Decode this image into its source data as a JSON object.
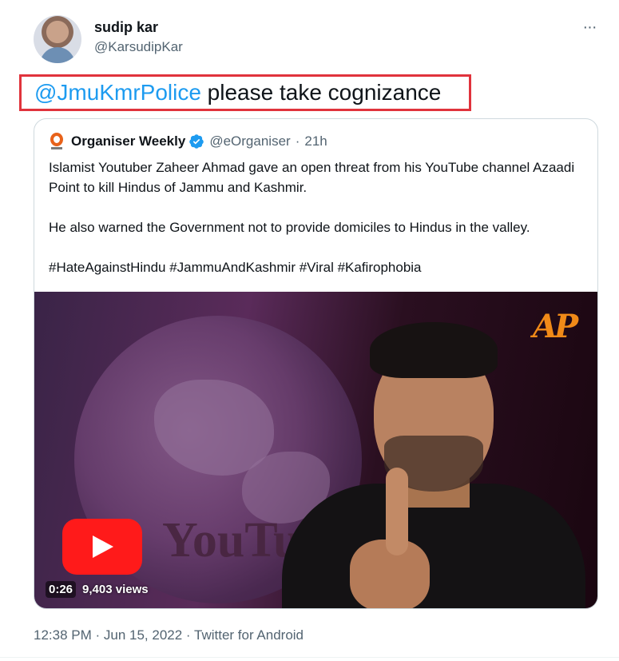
{
  "author": {
    "display_name": "sudip kar",
    "handle": "@KarsudipKar",
    "avatar_icon": "user-avatar"
  },
  "more_icon": "···",
  "tweet": {
    "mention": "@JmuKmrPolice",
    "text": " please take cognizance",
    "highlight_color": "#e0333c",
    "link_color": "#1d9bf0"
  },
  "quote": {
    "name": "Organiser Weekly",
    "handle": "@eOrganiser",
    "separator": "·",
    "time": "21h",
    "verified": true,
    "paragraphs": [
      "Islamist Youtuber Zaheer Ahmad gave an open threat from his YouTube channel Azaadi Point to kill Hindus of Jammu and Kashmir.",
      "He also warned the Government not to provide domiciles to Hindus in the valley.",
      "#HateAgainstHindu #JammuAndKashmir #Viral #Kafirophobia"
    ],
    "video": {
      "duration": "0:26",
      "views": "9,403 views",
      "watermark": "YouTub",
      "channel_logo": "AP"
    }
  },
  "footer": {
    "time": "12:38 PM",
    "sep1": " · ",
    "date": "Jun 15, 2022",
    "sep2": " · ",
    "source": "Twitter for Android"
  }
}
